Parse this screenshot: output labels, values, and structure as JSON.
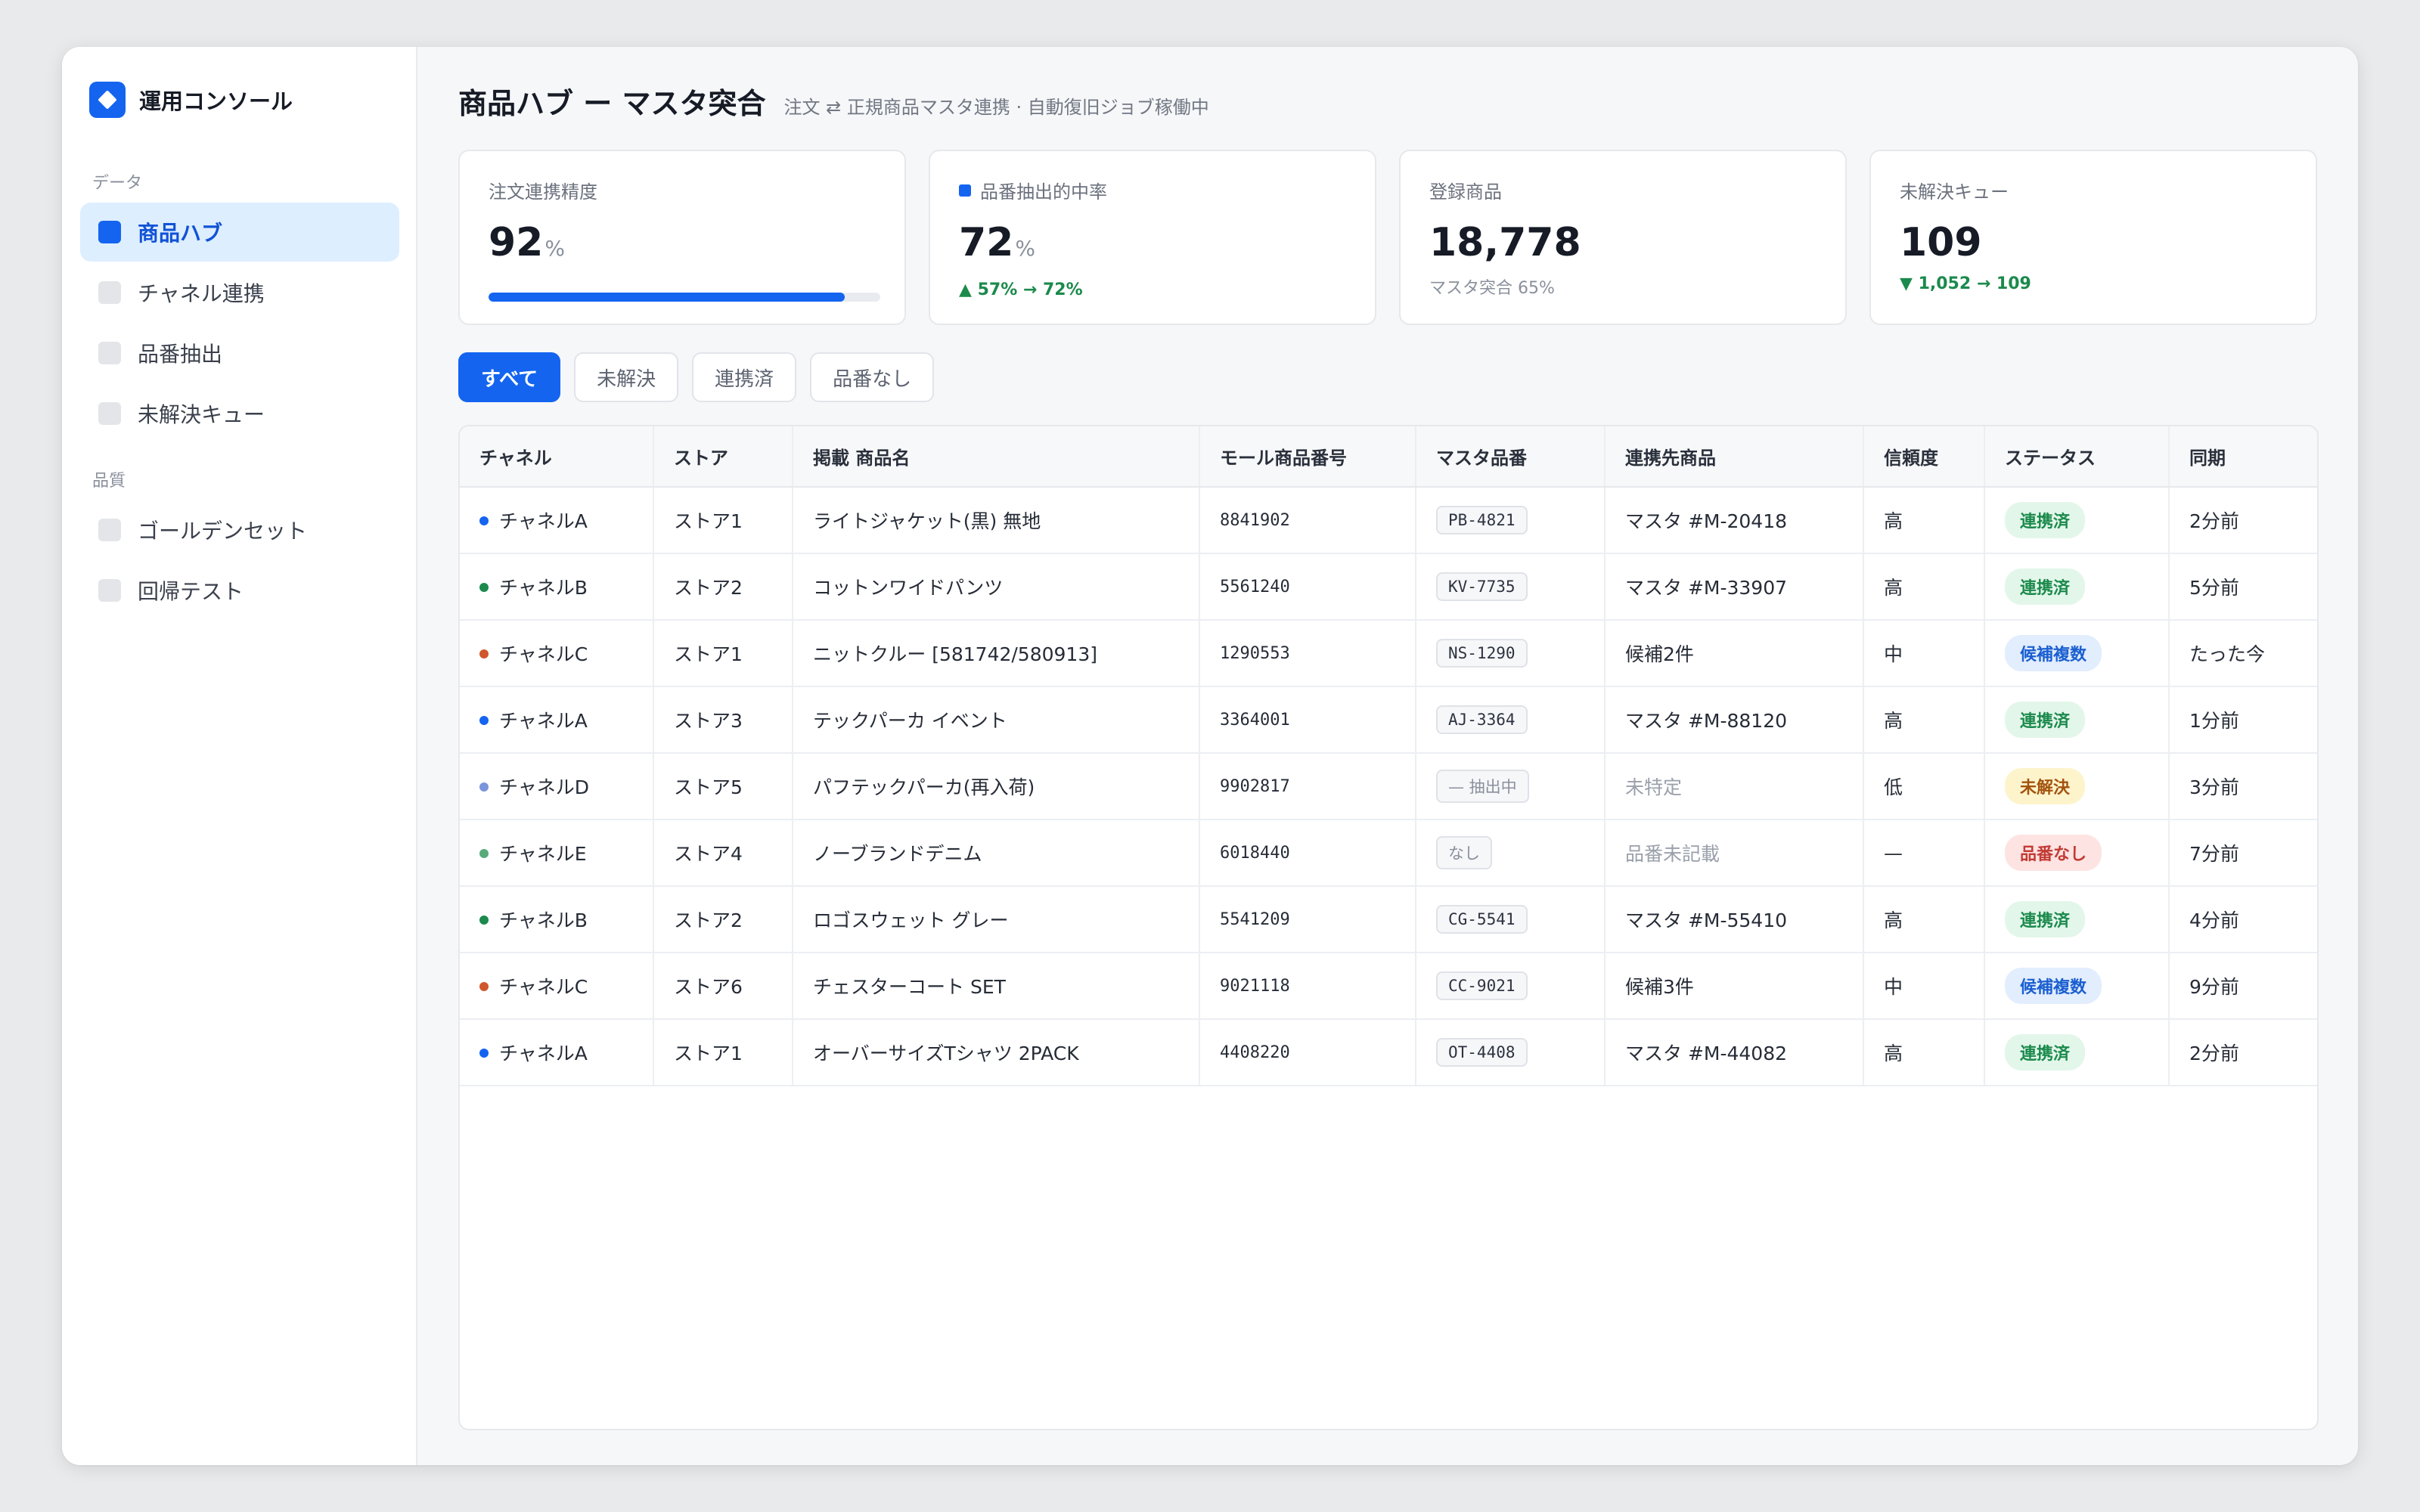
{
  "sidebar": {
    "brand": "運用コンソール",
    "sections": [
      {
        "label": "データ",
        "items": [
          {
            "label": "商品ハブ",
            "active": true
          },
          {
            "label": "チャネル連携",
            "active": false
          },
          {
            "label": "品番抽出",
            "active": false
          },
          {
            "label": "未解決キュー",
            "active": false
          }
        ]
      },
      {
        "label": "品質",
        "items": [
          {
            "label": "ゴールデンセット",
            "active": false
          },
          {
            "label": "回帰テスト",
            "active": false
          }
        ]
      }
    ]
  },
  "header": {
    "title": "商品ハブ ー マスタ突合",
    "subtitle": "注文 ⇄ 正規商品マスタ連携 · 自動復旧ジョブ稼働中"
  },
  "cards": [
    {
      "label": "注文連携精度",
      "value": "92",
      "unit": "%",
      "progress_percent": 91
    },
    {
      "label": "品番抽出的中率",
      "value": "72",
      "unit": "%",
      "sub": "▲ 57% → 72%"
    },
    {
      "label": "登録商品",
      "value": "18,778",
      "sub": "マスタ突合 65%"
    },
    {
      "label": "未解決キュー",
      "value": "109",
      "sub": "▼ 1,052 → 109"
    }
  ],
  "filters": [
    "すべて",
    "未解決",
    "連携済",
    "品番なし"
  ],
  "table": {
    "columns": [
      "チャネル",
      "ストア",
      "掲載 商品名",
      "モール商品番号",
      "マスタ品番",
      "連携先商品",
      "信頼度",
      "ステータス",
      "同期"
    ],
    "rows": [
      {
        "channel": "チャネルA",
        "dot": "#1464f0",
        "store": "ストア1",
        "name": "ライトジャケット(黒) 無地",
        "mall_no": "8841902",
        "sku": "PB-4821",
        "sku_muted": false,
        "linked": "マスタ #M-20418",
        "linked_muted": false,
        "confidence": "高",
        "status": "連携済",
        "status_type": "linked",
        "sync": "2分前"
      },
      {
        "channel": "チャネルB",
        "dot": "#1b8a4c",
        "store": "ストア2",
        "name": "コットンワイドパンツ",
        "mall_no": "5561240",
        "sku": "KV-7735",
        "sku_muted": false,
        "linked": "マスタ #M-33907",
        "linked_muted": false,
        "confidence": "高",
        "status": "連携済",
        "status_type": "linked",
        "sync": "5分前"
      },
      {
        "channel": "チャネルC",
        "dot": "#d0572b",
        "store": "ストア1",
        "name": "ニットクルー [581742/580913]",
        "mall_no": "1290553",
        "sku": "NS-1290",
        "sku_muted": false,
        "linked": "候補2件",
        "linked_muted": false,
        "confidence": "中",
        "status": "候補複数",
        "status_type": "multi",
        "sync": "たった今"
      },
      {
        "channel": "チャネルA",
        "dot": "#1464f0",
        "store": "ストア3",
        "name": "テックパーカ イベント",
        "mall_no": "3364001",
        "sku": "AJ-3364",
        "sku_muted": false,
        "linked": "マスタ #M-88120",
        "linked_muted": false,
        "confidence": "高",
        "status": "連携済",
        "status_type": "linked",
        "sync": "1分前"
      },
      {
        "channel": "チャネルD",
        "dot": "#7b95dc",
        "store": "ストア5",
        "name": "パフテックパーカ(再入荷)",
        "mall_no": "9902817",
        "sku": "— 抽出中",
        "sku_muted": true,
        "linked": "未特定",
        "linked_muted": true,
        "confidence": "低",
        "status": "未解決",
        "status_type": "unres",
        "sync": "3分前"
      },
      {
        "channel": "チャネルE",
        "dot": "#5aa97b",
        "store": "ストア4",
        "name": "ノーブランドデニム",
        "mall_no": "6018440",
        "sku": "なし",
        "sku_muted": true,
        "linked": "品番未記載",
        "linked_muted": true,
        "confidence": "—",
        "status": "品番なし",
        "status_type": "none",
        "sync": "7分前"
      },
      {
        "channel": "チャネルB",
        "dot": "#1b8a4c",
        "store": "ストア2",
        "name": "ロゴスウェット グレー",
        "mall_no": "5541209",
        "sku": "CG-5541",
        "sku_muted": false,
        "linked": "マスタ #M-55410",
        "linked_muted": false,
        "confidence": "高",
        "status": "連携済",
        "status_type": "linked",
        "sync": "4分前"
      },
      {
        "channel": "チャネルC",
        "dot": "#d0572b",
        "store": "ストア6",
        "name": "チェスターコート SET",
        "mall_no": "9021118",
        "sku": "CC-9021",
        "sku_muted": false,
        "linked": "候補3件",
        "linked_muted": false,
        "confidence": "中",
        "status": "候補複数",
        "status_type": "multi",
        "sync": "9分前"
      },
      {
        "channel": "チャネルA",
        "dot": "#1464f0",
        "store": "ストア1",
        "name": "オーバーサイズTシャツ 2PACK",
        "mall_no": "4408220",
        "sku": "OT-4408",
        "sku_muted": false,
        "linked": "マスタ #M-44082",
        "linked_muted": false,
        "confidence": "高",
        "status": "連携済",
        "status_type": "linked",
        "sync": "2分前"
      }
    ]
  }
}
